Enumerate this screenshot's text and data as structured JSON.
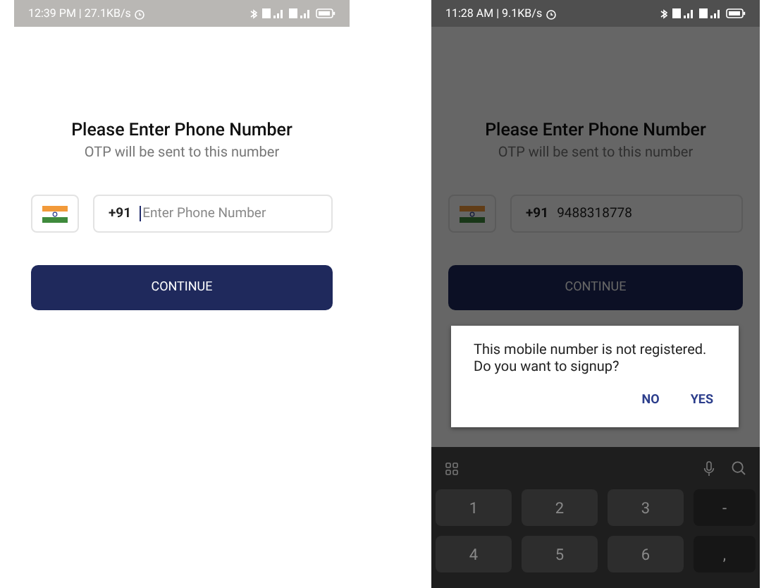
{
  "screens": [
    {
      "status_bar": {
        "text": "12:39 PM | 27.1KB/s"
      },
      "title": "Please Enter Phone Number",
      "subtitle": "OTP will be sent to this number",
      "phone_field": {
        "country_code": "+91",
        "placeholder": "Enter Phone Number",
        "focused": true
      },
      "continue_button": "CONTINUE"
    },
    {
      "status_bar": {
        "text": "11:28 AM | 9.1KB/s"
      },
      "title": "Please Enter Phone Number",
      "subtitle": "OTP will be sent to this number",
      "phone_field": {
        "country_code": "+91",
        "value": "9488318778",
        "focused": false
      },
      "continue_button": "CONTINUE",
      "dialog": {
        "message": "This mobile number is not registered. Do you want to signup?",
        "buttons": [
          "NO",
          "YES"
        ]
      },
      "keyboard": {
        "keys": [
          {
            "label": "1",
            "kind": "digit"
          },
          {
            "label": "2",
            "kind": "digit"
          },
          {
            "label": "3",
            "kind": "digit"
          },
          {
            "label": "-",
            "kind": "symbol"
          },
          {
            "label": "4",
            "kind": "digit"
          },
          {
            "label": "5",
            "kind": "digit"
          },
          {
            "label": "6",
            "kind": "digit"
          },
          {
            "label": ",",
            "kind": "symbol"
          }
        ]
      }
    }
  ]
}
